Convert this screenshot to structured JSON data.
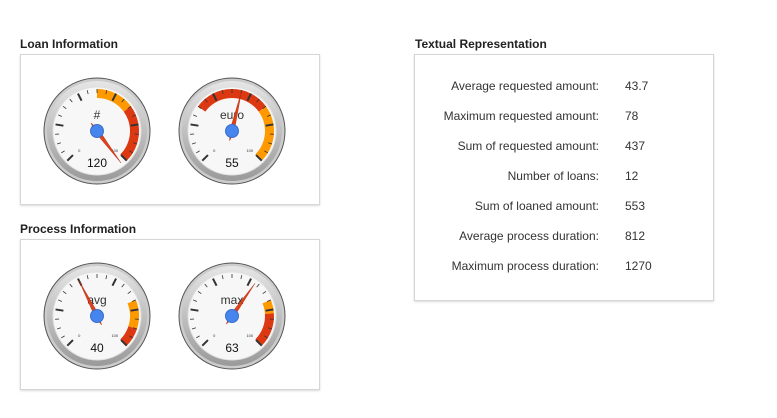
{
  "loan_section": {
    "title": "Loan Information",
    "gauges": [
      {
        "label": "#",
        "value": 120,
        "scale_min": "0",
        "scale_max": "100",
        "min": 0,
        "max": 100,
        "bands": [
          {
            "from": 50,
            "to": 70,
            "color": "#ff9900"
          },
          {
            "from": 70,
            "to": 100,
            "color": "#dc3912"
          }
        ]
      },
      {
        "label": "euro",
        "value": 55,
        "scale_min": "0",
        "scale_max": "100",
        "min": 0,
        "max": 100,
        "bands": [
          {
            "from": 30,
            "to": 70,
            "color": "#dc3912"
          },
          {
            "from": 70,
            "to": 100,
            "color": "#ff9900"
          }
        ]
      }
    ]
  },
  "process_section": {
    "title": "Process Information",
    "gauges": [
      {
        "label": "avg",
        "value": 40,
        "scale_min": "0",
        "scale_max": "100",
        "min": 0,
        "max": 100,
        "bands": [
          {
            "from": 75,
            "to": 90,
            "color": "#ff9900"
          },
          {
            "from": 90,
            "to": 100,
            "color": "#dc3912"
          }
        ]
      },
      {
        "label": "max",
        "value": 63,
        "scale_min": "0",
        "scale_max": "100",
        "min": 0,
        "max": 100,
        "bands": [
          {
            "from": 75,
            "to": 82,
            "color": "#ff9900"
          },
          {
            "from": 82,
            "to": 100,
            "color": "#dc3912"
          }
        ]
      }
    ]
  },
  "textual_section": {
    "title": "Textual Representation",
    "rows": [
      {
        "label": "Average requested amount:",
        "value": "43.7"
      },
      {
        "label": "Maximum requested amount:",
        "value": "78"
      },
      {
        "label": "Sum of requested amount:",
        "value": "437"
      },
      {
        "label": "Number of loans:",
        "value": "12"
      },
      {
        "label": "Sum of loaned amount:",
        "value": "553"
      },
      {
        "label": "Average process duration:",
        "value": "812"
      },
      {
        "label": "Maximum process duration:",
        "value": "1270"
      }
    ]
  },
  "colors": {
    "needle": "#dc3912",
    "pivot": "#4684ee",
    "warning": "#ff9900",
    "danger": "#dc3912"
  }
}
